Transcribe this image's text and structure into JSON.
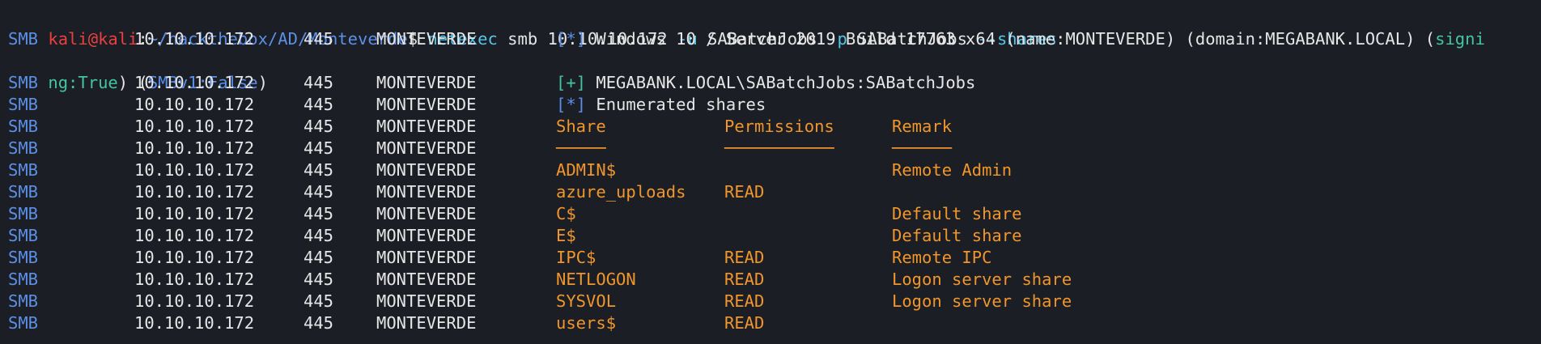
{
  "prompt": {
    "user": "kali@kali",
    "colon": ":",
    "path": "~/hackthebox/AD/Monteverde",
    "dollar": "$ ",
    "cmd_name": "netexec",
    "arg1": " smb 10.10.10.172 ",
    "flag_u": "-u",
    "arg_u": " SABatchJobs ",
    "flag_p": "-p",
    "arg_p": " SABatchJobs ",
    "flag_shares": "--shares"
  },
  "common": {
    "proto": "SMB",
    "ip": "10.10.10.172",
    "port": "445",
    "host": "MONTEVERDE"
  },
  "info_line": {
    "tag": "[*]",
    "text": " Windows 10 / Server 2019 Build 17763 x64 (name:MONTEVERDE) (domain:MEGABANK.LOCAL) (",
    "signing_part1": "signi",
    "signing_part2": "ng:True",
    "wrap_mid": ") (",
    "smbv1": "SMBv1:False",
    "wrap_end": ")"
  },
  "auth_line": {
    "tag": "[+]",
    "text": " MEGABANK.LOCAL\\SABatchJobs:SABatchJobs"
  },
  "enum_line": {
    "tag": "[*]",
    "text": " Enumerated shares"
  },
  "headers": {
    "share": "Share",
    "permissions": "Permissions",
    "remark": "Remark"
  },
  "underlines": {
    "share": "─────",
    "permissions": "───────────",
    "remark": "──────"
  },
  "shares": [
    {
      "name": "ADMIN$",
      "perm": "",
      "remark": "Remote Admin"
    },
    {
      "name": "azure_uploads",
      "perm": "READ",
      "remark": ""
    },
    {
      "name": "C$",
      "perm": "",
      "remark": "Default share"
    },
    {
      "name": "E$",
      "perm": "",
      "remark": "Default share"
    },
    {
      "name": "IPC$",
      "perm": "READ",
      "remark": "Remote IPC"
    },
    {
      "name": "NETLOGON",
      "perm": "READ",
      "remark": "Logon server share"
    },
    {
      "name": "SYSVOL",
      "perm": "READ",
      "remark": "Logon server share"
    },
    {
      "name": "users$",
      "perm": "READ",
      "remark": ""
    }
  ]
}
